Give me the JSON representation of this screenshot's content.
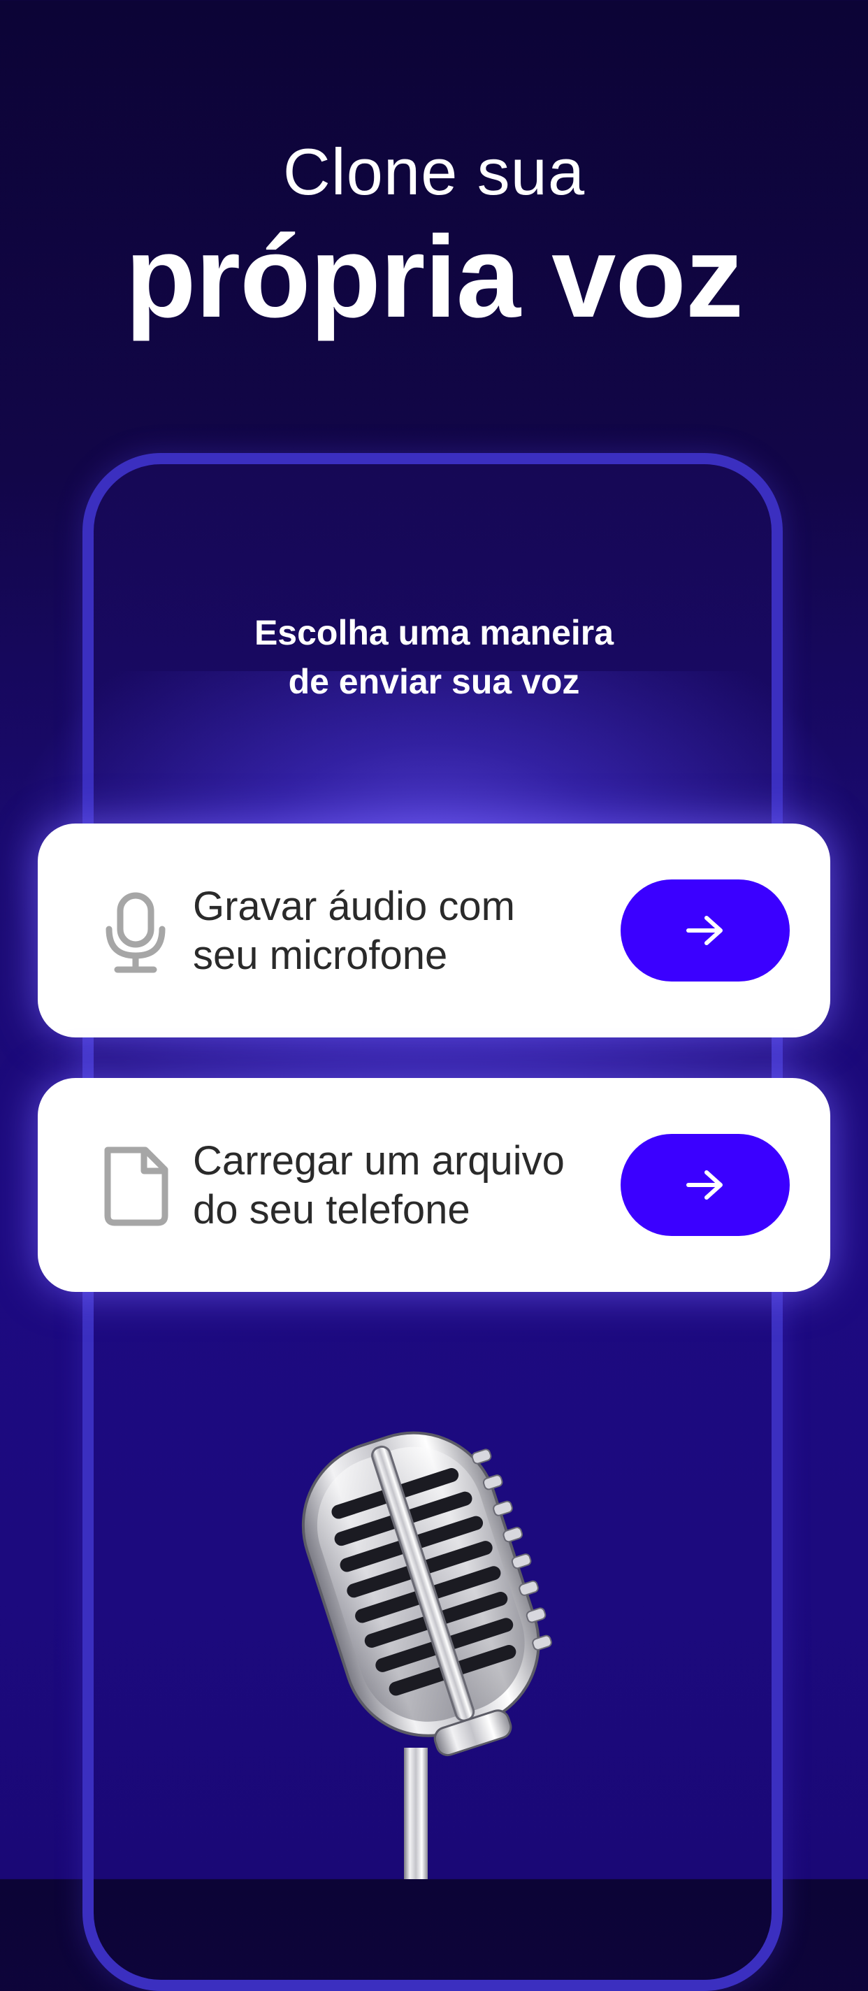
{
  "headline": {
    "line1": "Clone sua",
    "line2": "própria voz"
  },
  "subtitle": {
    "line1": "Escolha uma maneira",
    "line2": "de enviar sua voz"
  },
  "options": [
    {
      "label_line1": "Gravar áudio com",
      "label_line2": "seu microfone",
      "icon": "microphone-icon",
      "action_icon": "arrow-right-icon"
    },
    {
      "label_line1": "Carregar um arquivo",
      "label_line2": "do seu telefone",
      "icon": "file-icon",
      "action_icon": "arrow-right-icon"
    }
  ],
  "colors": {
    "background": "#120648",
    "accent": "#3b00ff",
    "frame": "#3b2fc0",
    "card": "#ffffff",
    "card_text": "#2a2a2a",
    "icon_gray": "#a6a6a6"
  },
  "illustration": "vintage-microphone"
}
